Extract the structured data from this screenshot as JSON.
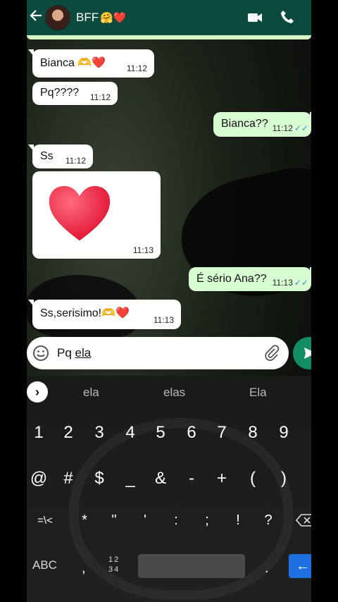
{
  "header": {
    "contact_name": "BFF",
    "name_emoji": "🤗❤️",
    "icons": {
      "back": "back-arrow-icon",
      "video": "video-call-icon",
      "call": "phone-icon"
    }
  },
  "messages": [
    {
      "direction": "in",
      "text": "Bianca 🫶❤️",
      "time": "11:12"
    },
    {
      "direction": "in",
      "text": "Pq????",
      "time": "11:12"
    },
    {
      "direction": "out",
      "text": "Bianca??",
      "time": "11:12",
      "status": "read"
    },
    {
      "direction": "in",
      "text": "Ss",
      "time": "11:12"
    },
    {
      "direction": "in",
      "type": "emoji-heart",
      "text": "",
      "time": "11:13"
    },
    {
      "direction": "out",
      "text": "É sério Ana??",
      "time": "11:13",
      "status": "read"
    },
    {
      "direction": "in",
      "text": "Ss,serisimo!🫶❤️",
      "time": "11:13"
    }
  ],
  "composer": {
    "text_prefix": "Pq ",
    "text_underlined": "ela"
  },
  "keyboard": {
    "suggestions": [
      "ela",
      "elas",
      "Ela"
    ],
    "row1": [
      "1",
      "2",
      "3",
      "4",
      "5",
      "6",
      "7",
      "8",
      "9"
    ],
    "row2": [
      "@",
      "#",
      "$",
      "_",
      "&",
      "-",
      "+",
      "(",
      ")"
    ],
    "row3": [
      "=\\<",
      "*",
      "\"",
      "'",
      ":",
      ";",
      "!",
      "?"
    ],
    "abc_label": "ABC",
    "comma": ",",
    "num_label_top": "12",
    "num_label_bottom": "34",
    "period": ".",
    "enter": "←"
  },
  "colors": {
    "header_bg": "#0b4a3e",
    "out_bubble": "#d9fdd3",
    "send_button": "#128c62",
    "read_ticks": "#3b8fd6",
    "enter_key": "#1e6fe0"
  }
}
